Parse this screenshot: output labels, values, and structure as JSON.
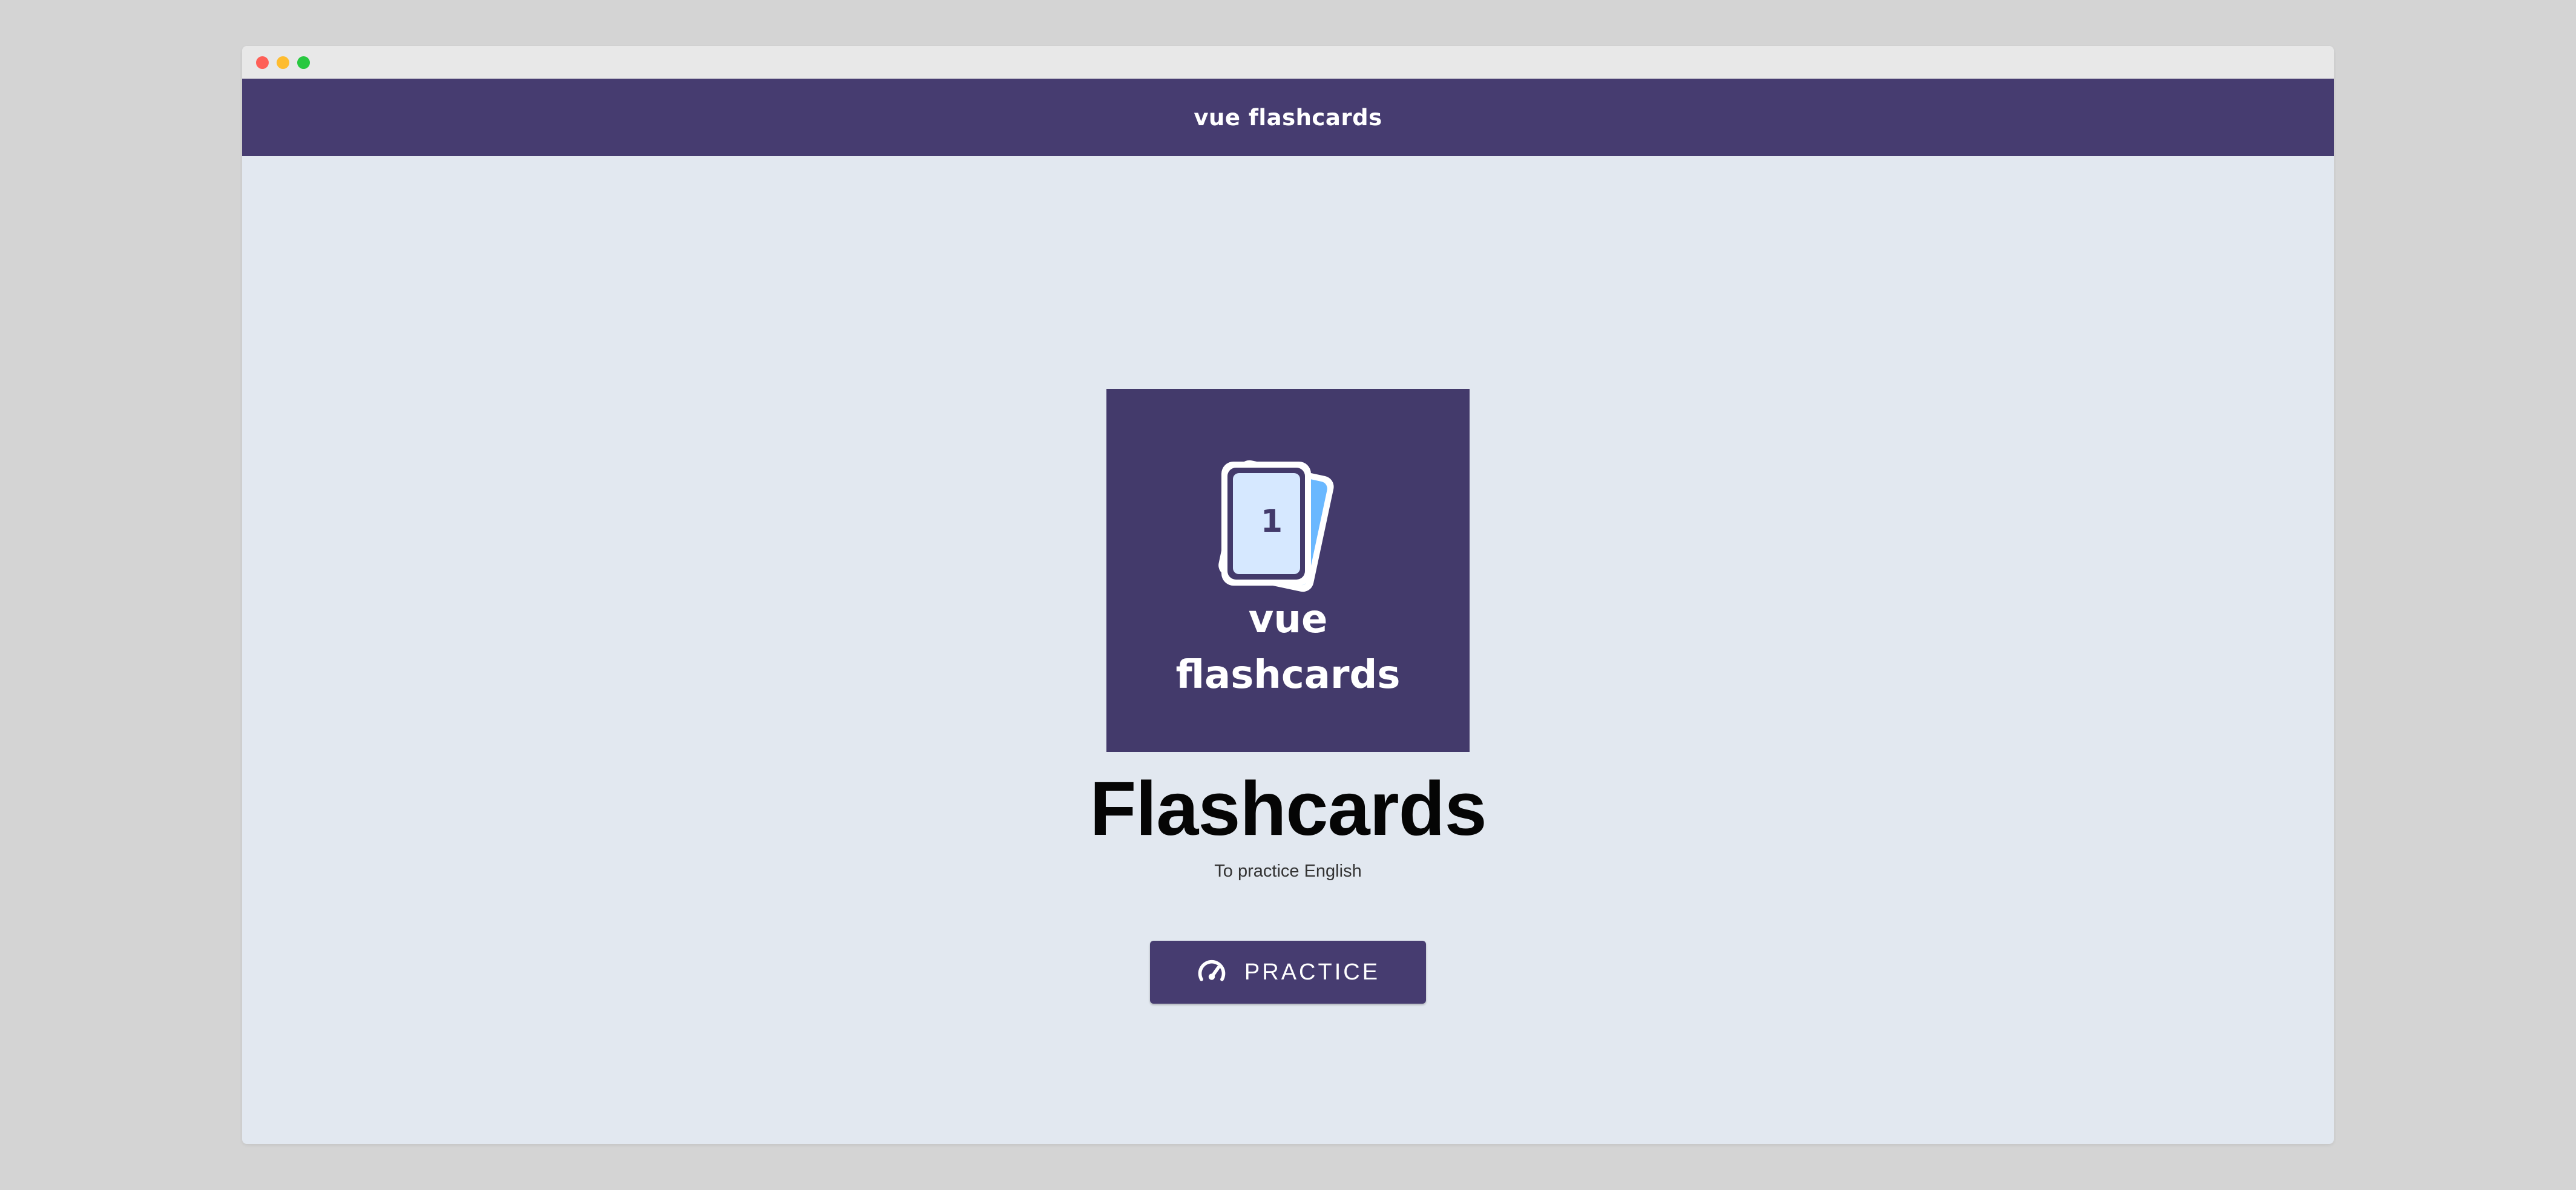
{
  "app": {
    "title": "vue flashcards"
  },
  "logo": {
    "card_number": "1",
    "line1": "vue",
    "line2": "flashcards"
  },
  "main": {
    "heading": "Flashcards",
    "subtitle": "To practice English",
    "practice_button": {
      "label": "PRACTICE",
      "icon": "speedometer-icon"
    }
  },
  "colors": {
    "brand": "#463c70",
    "background": "#e2e8f0",
    "card_light": "#d6e8ff",
    "card_blue": "#6ab8ff"
  }
}
